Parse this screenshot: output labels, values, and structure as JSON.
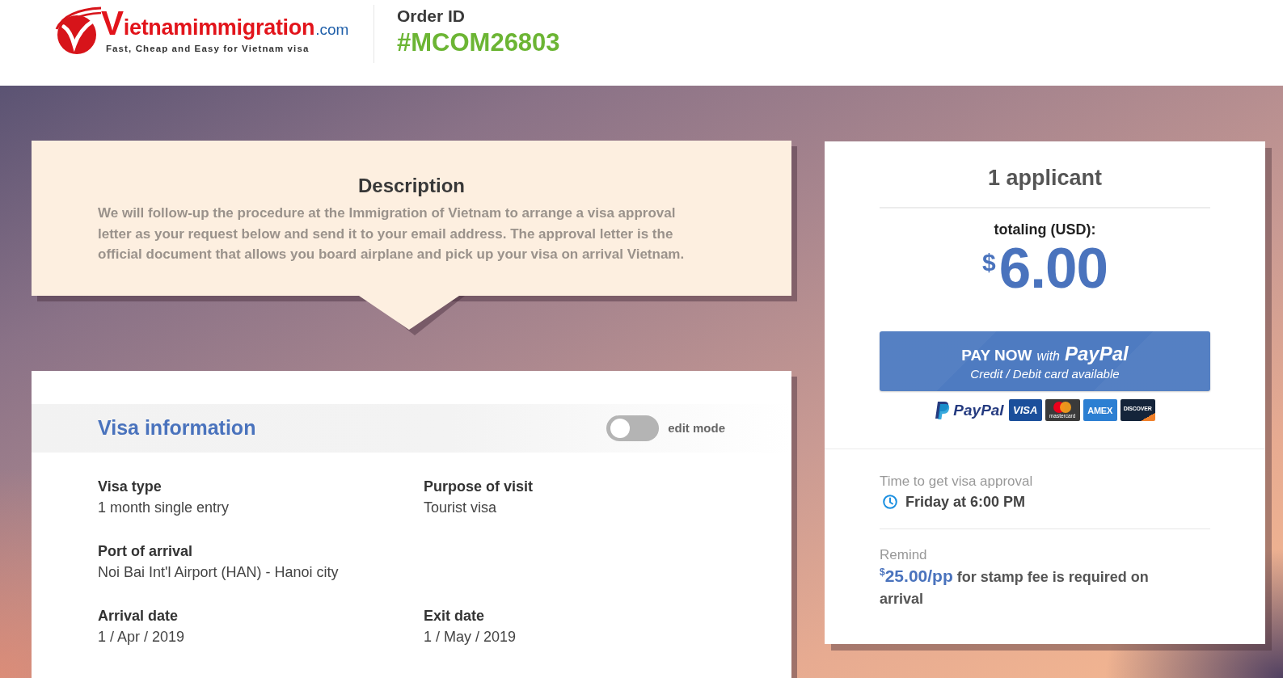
{
  "header": {
    "logo": {
      "name": "Vietnamimmigration",
      "domain": ".com",
      "tagline": "Fast, Cheap and Easy for Vietnam visa"
    },
    "order": {
      "label": "Order ID",
      "number": "#MCOM26803"
    }
  },
  "description": {
    "title": "Description",
    "text": "We will follow-up the procedure at the Immigration of Vietnam to arrange a visa approval letter as your request below and send it to your email address. The approval letter is the official document that allows you board airplane and pick up your visa on arrival Vietnam."
  },
  "visa_information": {
    "title": "Visa information",
    "edit_mode": {
      "label": "edit mode",
      "on": false
    },
    "rows": [
      {
        "fields": [
          {
            "label": "Visa type",
            "value": "1 month single entry"
          },
          {
            "label": "Purpose of visit",
            "value": "Tourist visa"
          }
        ]
      },
      {
        "fields": [
          {
            "label": "Port of arrival",
            "value": "Noi Bai Int'l Airport (HAN) - Hanoi city"
          }
        ]
      },
      {
        "fields": [
          {
            "label": "Arrival date",
            "value": "1 / Apr / 2019"
          },
          {
            "label": "Exit date",
            "value": "1 / May / 2019"
          }
        ]
      }
    ]
  },
  "summary": {
    "applicants": "1 applicant",
    "total_label": "totaling (USD):",
    "total": {
      "currency": "$",
      "amount": "6.00"
    },
    "pay_button": {
      "title": "PAY NOW",
      "connector": "with",
      "brand": "PayPal",
      "subtitle": "Credit / Debit card available"
    },
    "payment_methods": [
      {
        "kind": "paypal",
        "label": "PayPal"
      },
      {
        "kind": "visa",
        "label": "VISA"
      },
      {
        "kind": "mastercard",
        "label": "mastercard"
      },
      {
        "kind": "amex",
        "label": "AMEX"
      },
      {
        "kind": "discover",
        "label": "DISCOVER"
      }
    ],
    "approval": {
      "label": "Time to get visa approval",
      "value": "Friday at 6:00 PM"
    },
    "reminder": {
      "label": "Remind",
      "currency": "$",
      "amount": "25.00/pp",
      "text": "for stamp fee is required on arrival"
    }
  }
}
